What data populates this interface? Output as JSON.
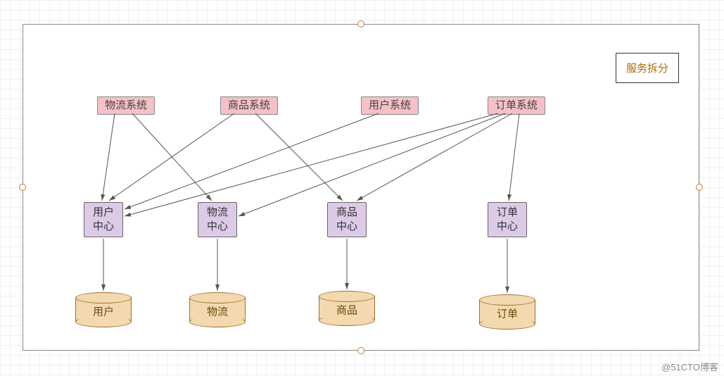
{
  "title": "服务拆分",
  "systems": {
    "logistics": "物流系统",
    "product": "商品系统",
    "user": "用户系统",
    "order": "订单系统"
  },
  "centers": {
    "user": {
      "line1": "用户",
      "line2": "中心"
    },
    "logistics": {
      "line1": "物流",
      "line2": "中心"
    },
    "product": {
      "line1": "商品",
      "line2": "中心"
    },
    "order": {
      "line1": "订单",
      "line2": "中心"
    }
  },
  "databases": {
    "user": "用户",
    "logistics": "物流",
    "product": "商品",
    "order": "订单"
  },
  "watermark": "@51CTO博客",
  "chart_data": {
    "type": "diagram",
    "title": "服务拆分",
    "nodes": [
      {
        "id": "sys_logistics",
        "kind": "system",
        "label": "物流系统"
      },
      {
        "id": "sys_product",
        "kind": "system",
        "label": "商品系统"
      },
      {
        "id": "sys_user",
        "kind": "system",
        "label": "用户系统"
      },
      {
        "id": "sys_order",
        "kind": "system",
        "label": "订单系统"
      },
      {
        "id": "ctr_user",
        "kind": "center",
        "label": "用户中心"
      },
      {
        "id": "ctr_logistics",
        "kind": "center",
        "label": "物流中心"
      },
      {
        "id": "ctr_product",
        "kind": "center",
        "label": "商品中心"
      },
      {
        "id": "ctr_order",
        "kind": "center",
        "label": "订单中心"
      },
      {
        "id": "db_user",
        "kind": "database",
        "label": "用户"
      },
      {
        "id": "db_logistics",
        "kind": "database",
        "label": "物流"
      },
      {
        "id": "db_product",
        "kind": "database",
        "label": "商品"
      },
      {
        "id": "db_order",
        "kind": "database",
        "label": "订单"
      }
    ],
    "edges": [
      {
        "from": "sys_logistics",
        "to": "ctr_user"
      },
      {
        "from": "sys_logistics",
        "to": "ctr_logistics"
      },
      {
        "from": "sys_product",
        "to": "ctr_user"
      },
      {
        "from": "sys_product",
        "to": "ctr_product"
      },
      {
        "from": "sys_user",
        "to": "ctr_user"
      },
      {
        "from": "sys_order",
        "to": "ctr_user"
      },
      {
        "from": "sys_order",
        "to": "ctr_logistics"
      },
      {
        "from": "sys_order",
        "to": "ctr_product"
      },
      {
        "from": "sys_order",
        "to": "ctr_order"
      },
      {
        "from": "ctr_user",
        "to": "db_user"
      },
      {
        "from": "ctr_logistics",
        "to": "db_logistics"
      },
      {
        "from": "ctr_product",
        "to": "db_product"
      },
      {
        "from": "ctr_order",
        "to": "db_order"
      }
    ]
  }
}
